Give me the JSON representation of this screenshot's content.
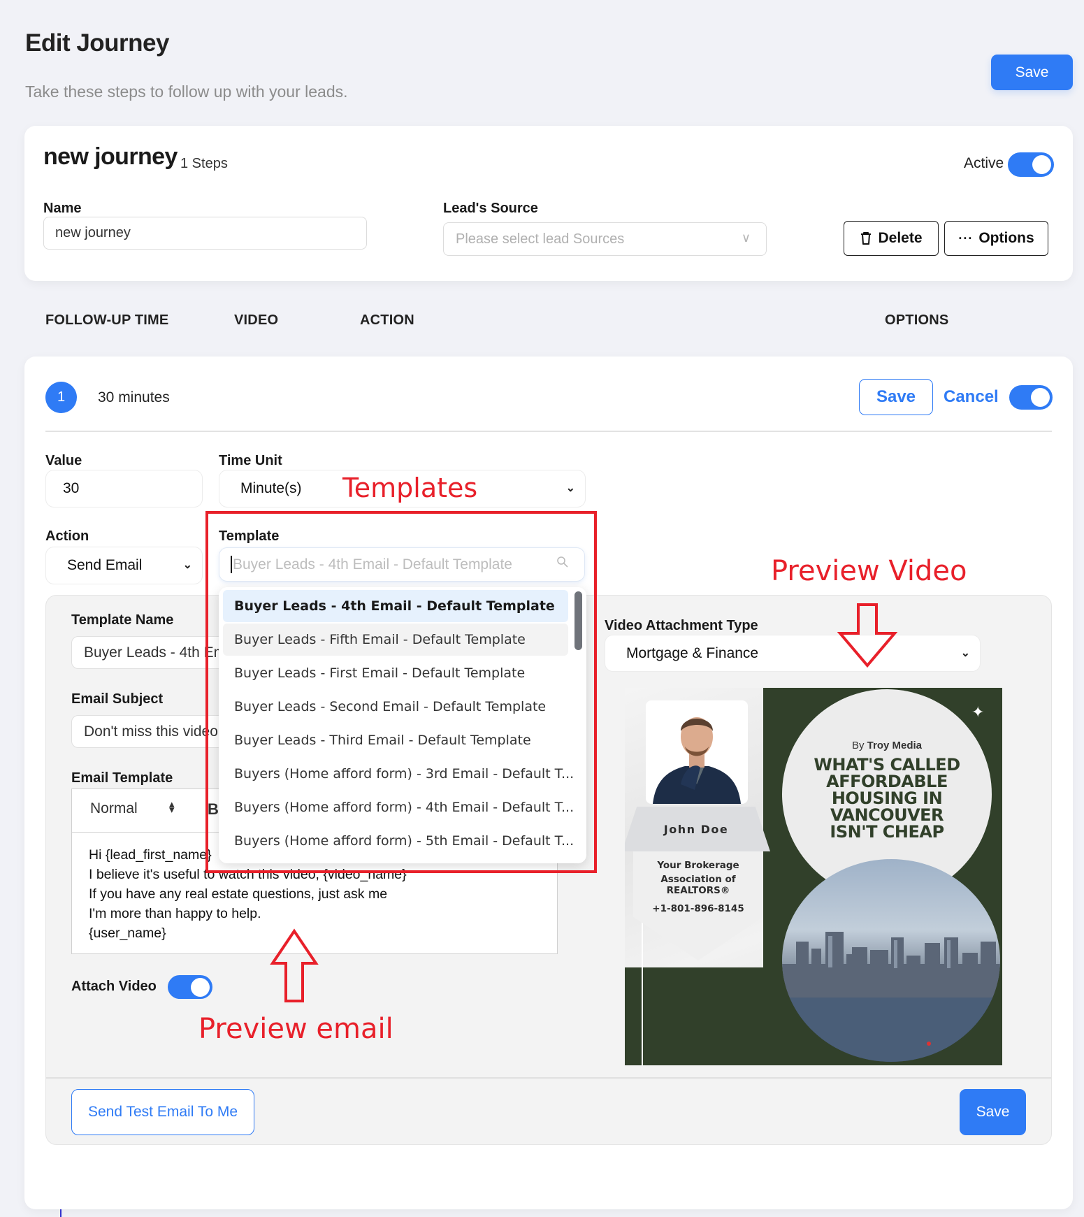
{
  "page": {
    "title": "Edit Journey",
    "subtitle": "Take these steps to follow up with your leads.",
    "save_label": "Save"
  },
  "journey": {
    "name": "new journey",
    "steps_count": "1 Steps",
    "active_label": "Active",
    "active": true,
    "name_label": "Name",
    "name_value": "new journey",
    "lead_source_label": "Lead's Source",
    "lead_source_placeholder": "Please select lead Sources",
    "delete_label": "Delete",
    "options_label": "Options"
  },
  "columns": [
    "FOLLOW-UP TIME",
    "VIDEO",
    "ACTION",
    "OPTIONS"
  ],
  "step": {
    "number": "1",
    "time_summary": "30 minutes",
    "save_label": "Save",
    "cancel_label": "Cancel",
    "enabled": true,
    "value_label": "Value",
    "value": "30",
    "time_unit_label": "Time Unit",
    "time_unit": "Minute(s)",
    "action_label": "Action",
    "action": "Send Email",
    "template_label": "Template",
    "template_search_placeholder": "Buyer Leads - 4th Email - Default Template",
    "template_options": [
      "Buyer Leads - 4th Email - Default Template",
      "Buyer Leads - Fifth Email - Default Template",
      "Buyer Leads - First Email - Default Template",
      "Buyer Leads - Second Email - Default Template",
      "Buyer Leads - Third Email - Default Template",
      "Buyers (Home afford form) - 3rd Email - Default T...",
      "Buyers (Home afford form) - 4th Email - Default T...",
      "Buyers (Home afford form) - 5th Email - Default T..."
    ],
    "template_selected_index": 0,
    "template_hover_index": 1
  },
  "email": {
    "template_name_label": "Template Name",
    "template_name_value": "Buyer Leads - 4th Email - Default Template",
    "subject_label": "Email Subject",
    "subject_value": "Don't miss this video",
    "email_template_label": "Email Template",
    "format_value": "Normal",
    "bold_label": "B",
    "body_lines": [
      "Hi {lead_first_name}",
      "I believe it's useful to watch this video, {video_name}",
      "If you have any real estate questions, just ask me",
      "I'm more than happy to help.",
      "{user_name}"
    ],
    "attach_video_label": "Attach Video",
    "attach_video": true
  },
  "video": {
    "attachment_type_label": "Video Attachment Type",
    "attachment_type": "Mortgage & Finance",
    "preview": {
      "agent_name": "John Doe",
      "brokerage": "Your Brokerage",
      "association_line1": "Association of",
      "association_line2": "REALTORS®",
      "phone": "+1-801-896-8145",
      "by_prefix": "By",
      "by_author": "Troy Media",
      "headline_lines": [
        "WHAT'S CALLED",
        "AFFORDABLE",
        "HOUSING IN",
        "VANCOUVER",
        "ISN'T CHEAP"
      ]
    }
  },
  "footer": {
    "send_test_label": "Send Test Email To Me",
    "save_label": "Save"
  },
  "annotations": {
    "templates": "Templates",
    "preview_video": "Preview Video",
    "preview_email": "Preview email",
    "color": "#e8202a"
  },
  "colors": {
    "accent": "#2f7bf5",
    "page_bg": "#f1f2f7",
    "panel_bg": "#f3f3f3",
    "preview_green": "#31402a"
  }
}
